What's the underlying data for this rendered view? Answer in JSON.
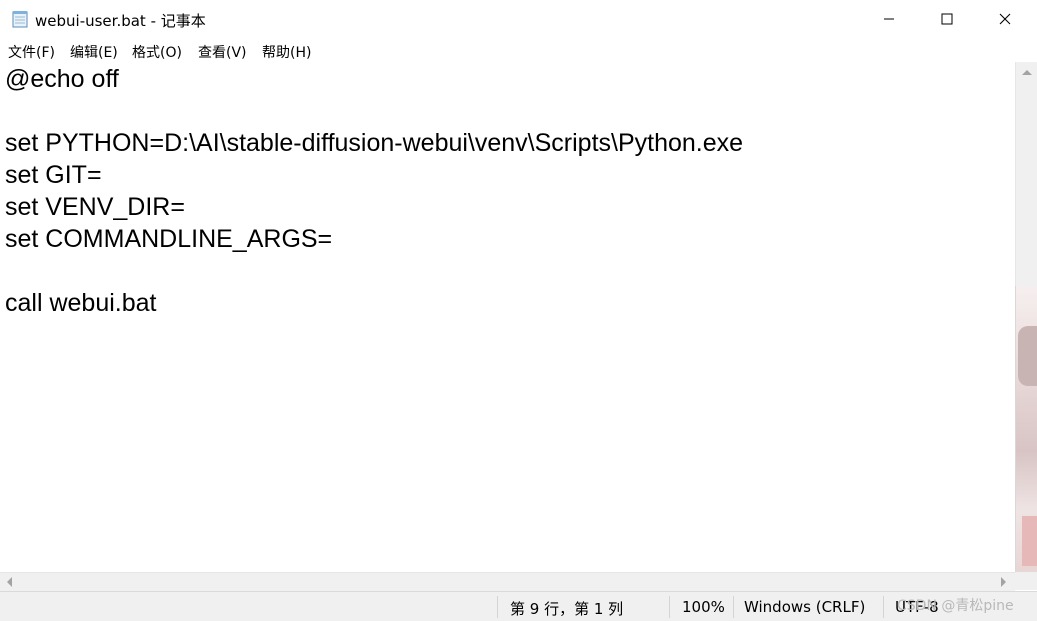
{
  "window": {
    "title": "webui-user.bat - 记事本",
    "app_icon": "notepad-icon",
    "controls": {
      "minimize": "minimize-icon",
      "maximize": "maximize-icon",
      "close": "close-icon"
    }
  },
  "menu": {
    "items": [
      {
        "label": "文件(F)"
      },
      {
        "label": "编辑(E)"
      },
      {
        "label": "格式(O)"
      },
      {
        "label": "查看(V)"
      },
      {
        "label": "帮助(H)"
      }
    ]
  },
  "editor": {
    "lines": [
      "@echo off",
      "",
      "set PYTHON=D:\\AI\\stable-diffusion-webui\\venv\\Scripts\\Python.exe",
      "set GIT=",
      "set VENV_DIR=",
      "set COMMANDLINE_ARGS=",
      "",
      "call webui.bat"
    ]
  },
  "statusbar": {
    "position": "第 9 行，第 1 列",
    "zoom": "100%",
    "line_ending": "Windows (CRLF)",
    "encoding": "UTF-8"
  },
  "watermark": "CSDN @青松pine",
  "colors": {
    "background": "#ffffff",
    "chrome": "#f0f0f0",
    "text": "#000000"
  }
}
